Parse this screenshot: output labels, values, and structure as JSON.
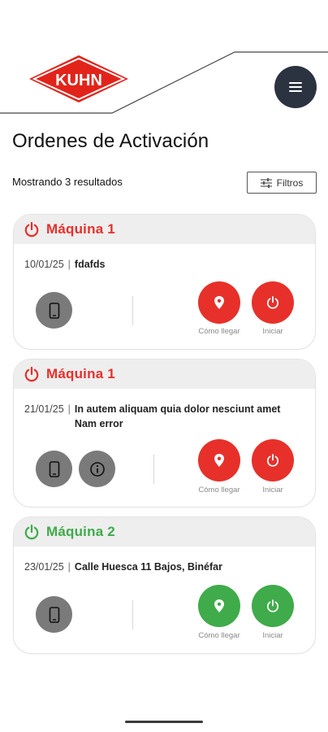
{
  "brand": {
    "logo_text": "KUHN",
    "logo_red": "#e2231a"
  },
  "header": {
    "title": "Ordenes de Activación",
    "results_text": "Mostrando 3 resultados",
    "filter_label": "Filtros"
  },
  "colors": {
    "red": "#e7302a",
    "green": "#3fab4a",
    "grey_button": "#7a7a7a",
    "menu_bg": "#2b3240"
  },
  "labels": {
    "directions": "Cómo llegar",
    "start": "Iniciar"
  },
  "cards": [
    {
      "title": "Máquina 1",
      "status": "red",
      "date": "10/01/25",
      "description": "fdafds",
      "has_info": false
    },
    {
      "title": "Máquina 1",
      "status": "red",
      "date": "21/01/25",
      "description": "In autem aliquam quia dolor nesciunt amet Nam error",
      "has_info": true
    },
    {
      "title": "Máquina 2",
      "status": "green",
      "date": "23/01/25",
      "description": "Calle Huesca 11 Bajos, Binéfar",
      "has_info": false
    }
  ],
  "icons": [
    "power-icon",
    "phone-icon",
    "info-icon",
    "location-pin-icon",
    "filter-sliders-icon",
    "menu-icon"
  ]
}
